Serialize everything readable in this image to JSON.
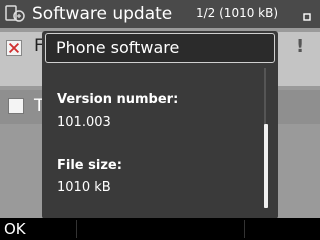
{
  "statusbar": {
    "title": "Software update",
    "counter": "1/2 (1010 kB)",
    "app_icon": "software-update-icon",
    "signal_icon": "signal-icon"
  },
  "background": {
    "row1_text": "F",
    "row2_text": "T",
    "row1_icon": "unchecked-red-icon",
    "row2_icon": "checkbox-icon",
    "alert_text": "!"
  },
  "popup": {
    "title": "Phone software",
    "version_label": "Version number:",
    "version_value": "101.003",
    "size_label": "File size:",
    "size_value": "1010 kB"
  },
  "softkeys": {
    "left": "OK"
  },
  "colors": {
    "statusbar": "#4a4a4a",
    "popup_bg": "#3a3a3a",
    "checkbox_mark": "#d03030"
  }
}
